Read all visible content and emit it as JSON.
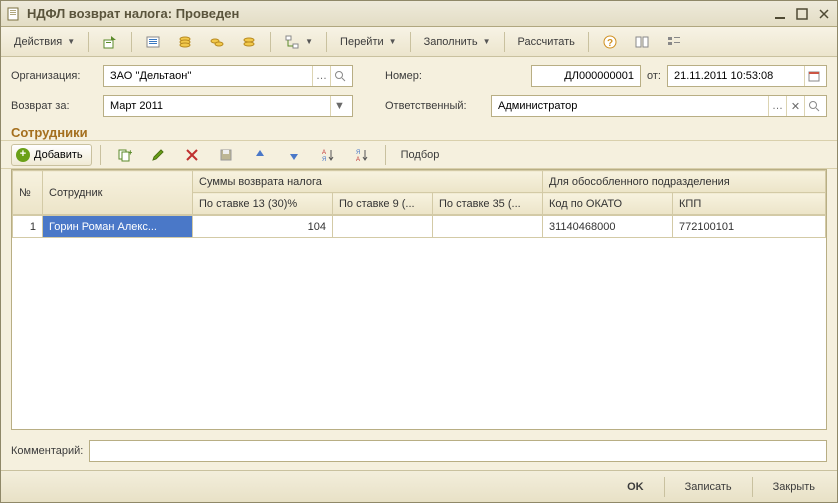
{
  "window": {
    "title": "НДФЛ возврат налога: Проведен"
  },
  "toolbar": {
    "actions": "Действия",
    "goto": "Перейти",
    "fill": "Заполнить",
    "calc": "Рассчитать"
  },
  "form": {
    "org_label": "Организация:",
    "org_value": "ЗАО ''Дельтаон''",
    "return_label": "Возврат за:",
    "return_value": "Март 2011",
    "number_label": "Номер:",
    "number_value": "ДЛ000000001",
    "from_label": "от:",
    "date_value": "21.11.2011 10:53:08",
    "responsible_label": "Ответственный:",
    "responsible_value": "Администратор"
  },
  "section": {
    "title": "Сотрудники"
  },
  "tabletools": {
    "add": "Добавить",
    "pick": "Подбор"
  },
  "grid": {
    "headers": {
      "num": "№",
      "employee": "Сотрудник",
      "sums_group": "Суммы возврата налога",
      "rate13": "По ставке 13 (30)%",
      "rate9": "По ставке 9 (...",
      "rate35": "По ставке 35 (...",
      "sep_group": "Для обособленного подразделения",
      "okato": "Код по ОКАТО",
      "kpp": "КПП"
    },
    "rows": [
      {
        "num": "1",
        "employee": "Горин Роман Алекс...",
        "r13": "104",
        "r9": "",
        "r35": "",
        "okato": "31140468000",
        "kpp": "772100101"
      }
    ]
  },
  "comment": {
    "label": "Комментарий:",
    "value": ""
  },
  "footer": {
    "ok": "OK",
    "save": "Записать",
    "close": "Закрыть"
  }
}
